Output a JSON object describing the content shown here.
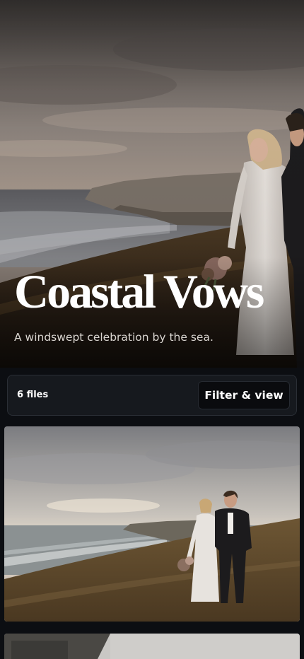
{
  "hero": {
    "title": "Coastal Vows",
    "subtitle": "A windswept celebration by the sea."
  },
  "toolbar": {
    "file_count": "6 files",
    "filter_label": "Filter & view"
  },
  "gallery": {
    "items": [
      {
        "subject": "couple-on-clifftop-photo"
      },
      {
        "subject": "building-and-sky-photo"
      }
    ]
  }
}
